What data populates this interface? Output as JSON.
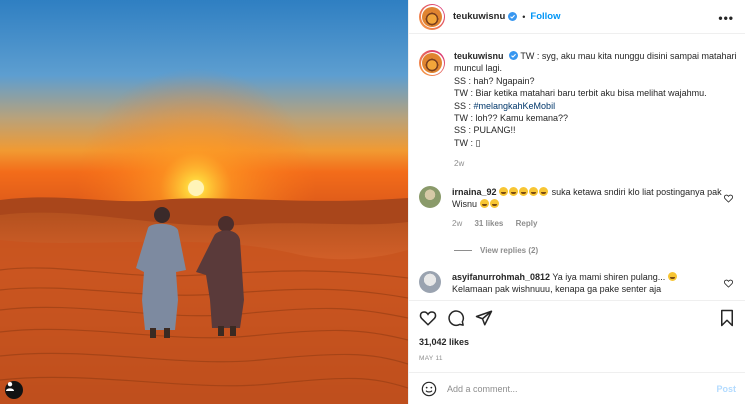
{
  "post": {
    "username": "teukuwisnu",
    "follow_label": "Follow",
    "separator": "•",
    "more_label": "•••",
    "caption_lines": [
      "TW : syg, aku mau kita nunggu disini sampai matahari muncul lagi.",
      "SS : hah? Ngapain?",
      "TW : Biar ketika matahari baru terbit aku bisa melihat wajahmu.",
      "SS : ",
      "TW : loh?? Kamu kemana??",
      "SS : PULANG!!",
      "TW : ▯"
    ],
    "hashtag": "#melangkahKeMobil",
    "caption_time": "2w"
  },
  "comments": [
    {
      "username": "irnaina_92",
      "text_after_emoji": "suka ketawa sndiri klo liat postinganya pak Wisnu",
      "time": "2w",
      "likes": "31 likes",
      "reply_label": "Reply",
      "view_replies": "View replies (2)"
    },
    {
      "username": "asyifanurrohmah_0812",
      "text": "Ya iya mami shiren pulang...",
      "text2": "Kelamaan pak wishnuuu, kenapa ga pake senter aja"
    }
  ],
  "actions": {
    "likes": "31,042 likes",
    "date": "MAY 11"
  },
  "add_comment": {
    "placeholder": "Add a comment...",
    "post_label": "Post"
  },
  "colors": {
    "follow_blue": "#0095f6",
    "hashtag_blue": "#00376b",
    "post_disabled": "#b3dbff",
    "verified_blue": "#3897f0"
  },
  "icons": [
    "verified-icon",
    "more-icon",
    "heart-icon",
    "comment-icon",
    "share-icon",
    "bookmark-icon",
    "emoji-icon",
    "tag-user-icon"
  ]
}
